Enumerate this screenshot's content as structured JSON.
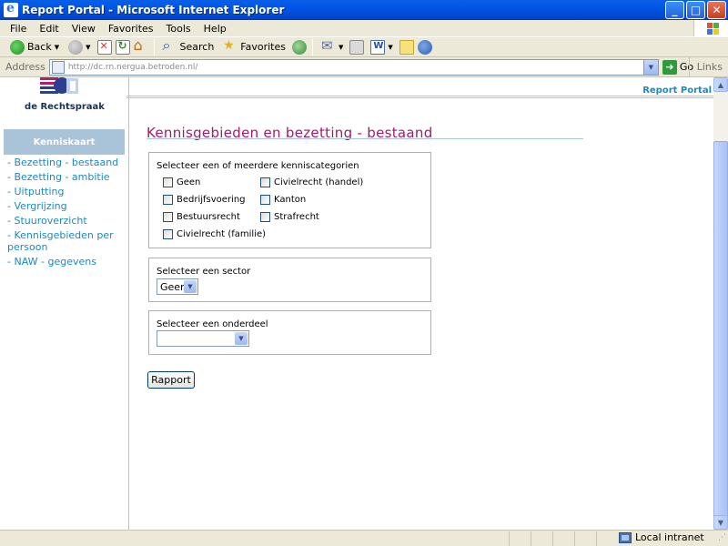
{
  "window": {
    "title": "Report Portal - Microsoft Internet Explorer",
    "minimize": "_",
    "maximize": "□",
    "close": "✕"
  },
  "menu": [
    "File",
    "Edit",
    "View",
    "Favorites",
    "Tools",
    "Help"
  ],
  "toolbar": {
    "back": "Back",
    "search": "Search",
    "favorites": "Favorites"
  },
  "address": {
    "label": "Address",
    "url": "http://dc.rn.nergua.betroden.nl/",
    "go": "Go",
    "links": "Links"
  },
  "site": {
    "logo_text": "de Rechtspraak",
    "portal_label": "Report Portal",
    "colors": {
      "accent_blue": "#1E88C0",
      "title_magenta": "#A8176F",
      "nav_header_bg": "#A9C4D8"
    }
  },
  "nav": {
    "header": "Kenniskaart",
    "items": [
      "- Bezetting - bestaand",
      "- Bezetting - ambitie",
      "- Uitputting",
      "- Vergrijzing",
      "- Stuuroverzicht",
      "- Kennisgebieden per persoon",
      "- NAW - gegevens"
    ]
  },
  "main": {
    "title": "Kennisgebieden en bezetting - bestaand",
    "categories": {
      "label": "Selecteer een of meerdere kenniscategorien",
      "left": [
        "Geen",
        "Bedrijfsvoering",
        "Bestuursrecht",
        "Civielrecht (familie)"
      ],
      "right": [
        "Civielrecht (handel)",
        "Kanton",
        "Strafrecht"
      ]
    },
    "sector": {
      "label": "Selecteer een sector",
      "selected": "Geen"
    },
    "onderdeel": {
      "label": "Selecteer een onderdeel",
      "selected": ""
    },
    "report_button": "Rapport"
  },
  "status": {
    "zone": "Local intranet"
  }
}
